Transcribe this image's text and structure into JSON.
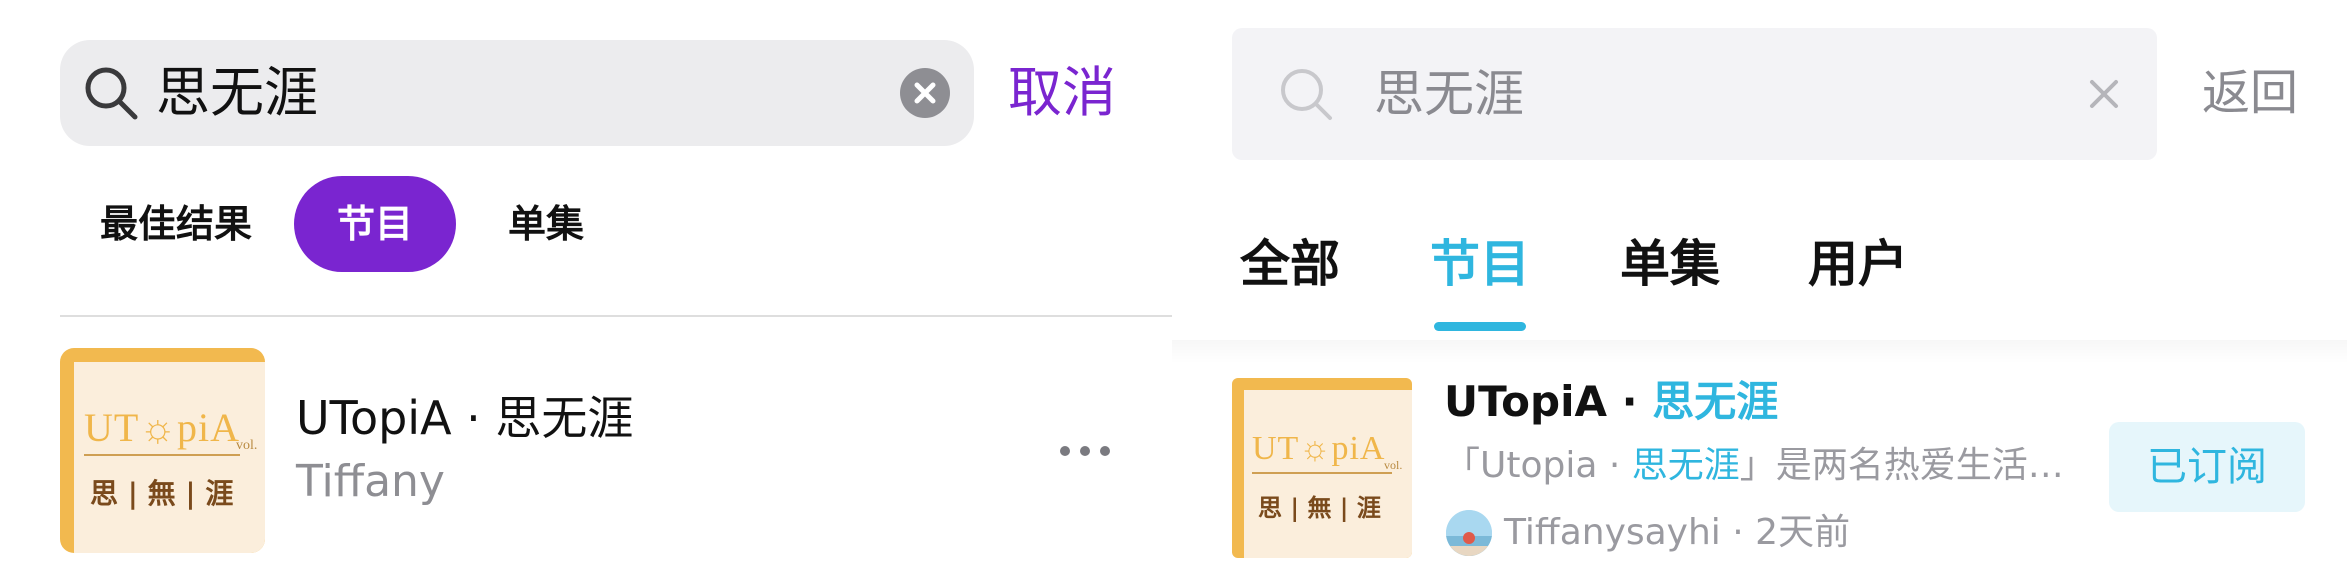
{
  "left": {
    "search": {
      "query": "思无涯",
      "cancel_label": "取消"
    },
    "tabs": [
      {
        "label": "最佳结果",
        "active": false
      },
      {
        "label": "节目",
        "active": true
      },
      {
        "label": "单集",
        "active": false
      }
    ],
    "result": {
      "title": "UTopiA · 思无涯",
      "author": "Tiffany",
      "cover": {
        "title": "UT☼piA",
        "vol": "vol.",
        "subtitle": "思 | 無 | 涯"
      }
    },
    "accent_color": "#7a25d0"
  },
  "right": {
    "search": {
      "query": "思无涯",
      "back_label": "返回"
    },
    "tabs": [
      {
        "label": "全部",
        "active": false
      },
      {
        "label": "节目",
        "active": true
      },
      {
        "label": "单集",
        "active": false
      },
      {
        "label": "用户",
        "active": false
      }
    ],
    "result": {
      "title_prefix": "UTopiA · ",
      "title_highlight": "思无涯",
      "desc_prefix": "「Utopia · ",
      "desc_highlight": "思无涯",
      "desc_suffix": "」是两名热爱生活…",
      "author": "Tiffanysayhi",
      "separator": "·",
      "time": "2天前",
      "subscribe_label": "已订阅",
      "cover": {
        "title": "UT☼piA",
        "vol": "vol.",
        "subtitle": "思 | 無 | 涯"
      }
    },
    "accent_color": "#2fb6df"
  }
}
